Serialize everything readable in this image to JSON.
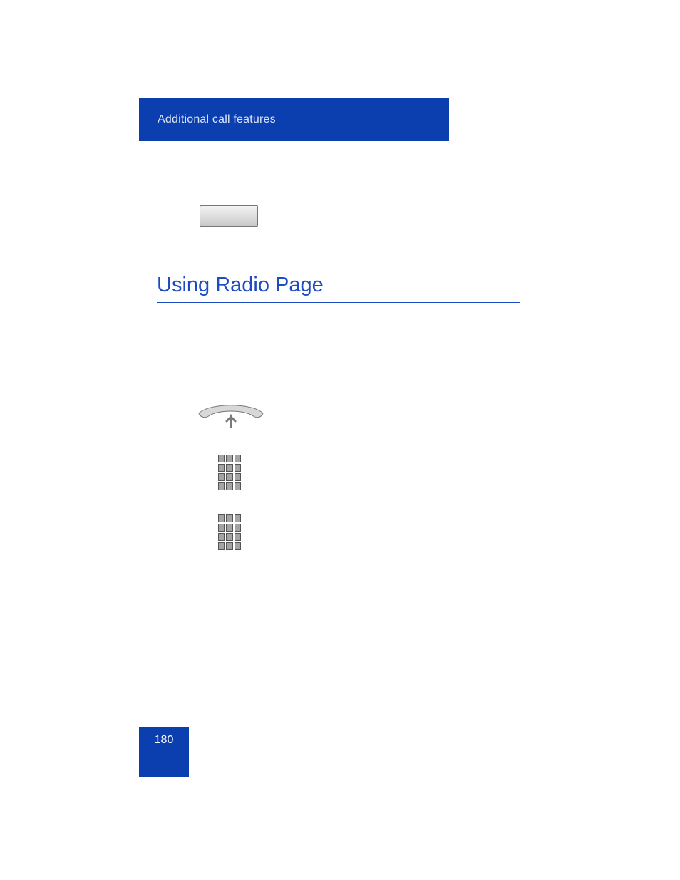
{
  "header": {
    "title": "Additional call features"
  },
  "section": {
    "title": "Using Radio Page"
  },
  "page_number": "180",
  "icons": {
    "key_button": "blank-key",
    "handset": "lift-handset",
    "keypad": "dial-keypad"
  }
}
